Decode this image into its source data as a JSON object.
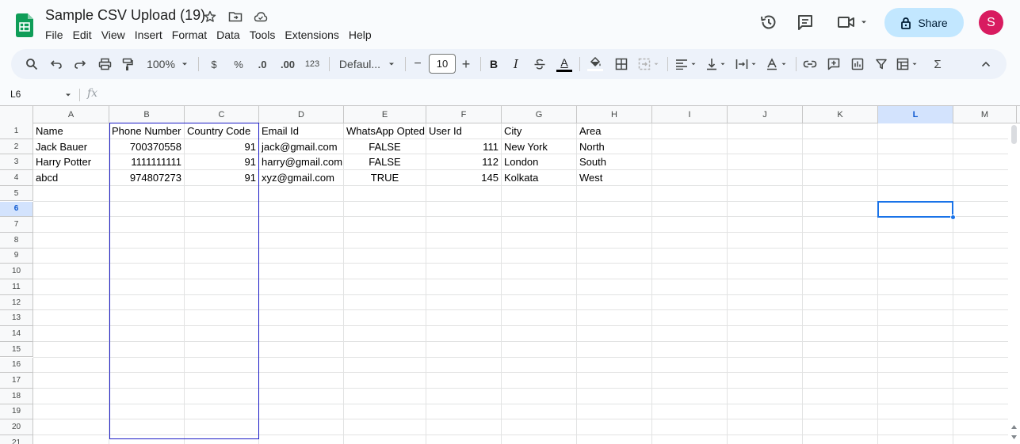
{
  "header": {
    "title": "Sample CSV Upload (19)",
    "menu": [
      "File",
      "Edit",
      "View",
      "Insert",
      "Format",
      "Data",
      "Tools",
      "Extensions",
      "Help"
    ],
    "share_label": "Share",
    "avatar_initial": "S"
  },
  "toolbar": {
    "zoom": "100%",
    "currency": "$",
    "percent": "%",
    "decrease_decimal": ".0",
    "increase_decimal": ".00",
    "number_format": "123",
    "font": "Defaul...",
    "font_size": "10",
    "minus": "−",
    "plus": "+",
    "bold": "B",
    "italic": "I",
    "text_color": "A",
    "sigma": "Σ"
  },
  "formula_bar": {
    "cell_ref": "L6",
    "fx": "fx"
  },
  "grid": {
    "columns": [
      "A",
      "B",
      "C",
      "D",
      "E",
      "F",
      "G",
      "H",
      "I",
      "J",
      "K",
      "L",
      "M"
    ],
    "row_numbers": [
      "1",
      "2",
      "3",
      "4",
      "5",
      "6",
      "7",
      "8",
      "9",
      "10",
      "11",
      "12",
      "13",
      "14",
      "15",
      "16",
      "17",
      "18",
      "19",
      "20",
      "21"
    ],
    "selected_column": "L",
    "selected_row": "6",
    "rows": [
      [
        "Name",
        "Phone Number",
        "Country Code",
        "Email Id",
        "WhatsApp Opted",
        "User Id",
        "City",
        "Area"
      ],
      [
        "Jack Bauer",
        "700370558",
        "91",
        "jack@gmail.com",
        "FALSE",
        "111",
        "New York",
        "North"
      ],
      [
        "Harry Potter",
        "1111111111",
        "91",
        "harry@gmail.com",
        "FALSE",
        "112",
        "London",
        "South"
      ],
      [
        "abcd",
        "974807273",
        "91",
        "xyz@gmail.com",
        "TRUE",
        "145",
        "Kolkata",
        "West"
      ]
    ]
  },
  "colors": {
    "share_bg": "#c2e7ff",
    "avatar_bg": "#d81b60",
    "selection_blue": "#1a73e8",
    "range_border": "#1b1bc6",
    "sheets_green": "#0f9d58"
  }
}
